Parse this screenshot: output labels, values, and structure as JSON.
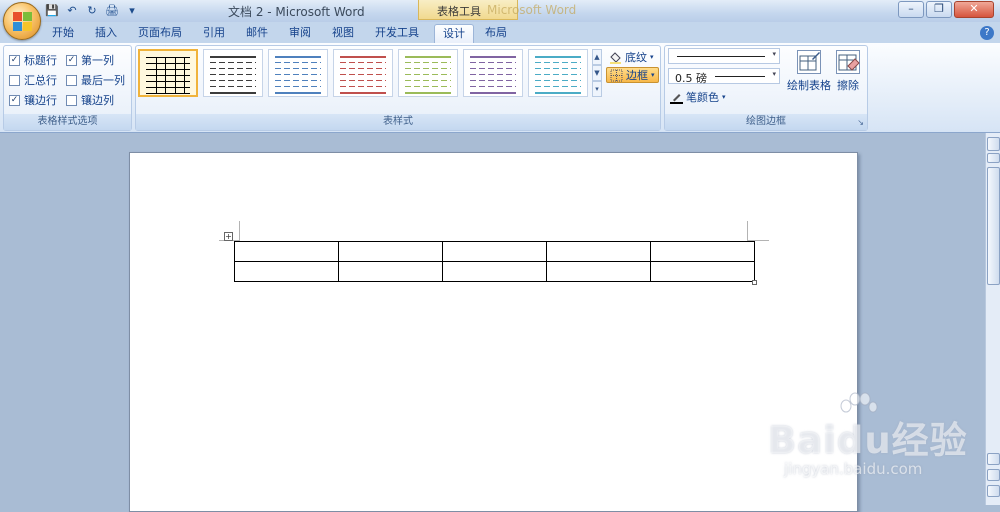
{
  "window": {
    "title": "文档 2 - Microsoft Word",
    "contextual_tab_group": "表格工具",
    "contextual_ghost": "Microsoft Word",
    "controls": {
      "minimize": "–",
      "restore": "❐",
      "close": "✕"
    }
  },
  "quick_access": {
    "save_icon": "💾",
    "undo_icon": "↶",
    "redo_icon": "↻",
    "print_icon": "🖨",
    "more_icon": "▾"
  },
  "tabs": [
    "开始",
    "插入",
    "页面布局",
    "引用",
    "邮件",
    "审阅",
    "视图",
    "开发工具",
    "设计",
    "布局"
  ],
  "active_tab": "设计",
  "help": "?",
  "ribbon": {
    "style_options": {
      "label": "表格样式选项",
      "items": [
        {
          "label": "标题行",
          "checked": true
        },
        {
          "label": "第一列",
          "checked": true
        },
        {
          "label": "汇总行",
          "checked": false
        },
        {
          "label": "最后一列",
          "checked": false
        },
        {
          "label": "镶边行",
          "checked": true
        },
        {
          "label": "镶边列",
          "checked": false
        }
      ],
      "check_mark": "✓"
    },
    "table_styles": {
      "label": "表样式",
      "shading_label": "底纹",
      "border_label": "边框",
      "thumb_colors": [
        "#000000",
        "#3c3c3c",
        "#4f81bd",
        "#c0504d",
        "#9bbb59",
        "#8064a2",
        "#4bacc6"
      ]
    },
    "draw_borders": {
      "label": "绘图边框",
      "weight": "0.5 磅",
      "pen_color_label": "笔颜色",
      "draw_table_label": "绘制表格",
      "eraser_label": "擦除"
    }
  },
  "document": {
    "rows": 2,
    "cols": 5,
    "move_handle": "+"
  },
  "watermark": {
    "main": "Baidu经验",
    "sub": "jingyan.baidu.com"
  }
}
